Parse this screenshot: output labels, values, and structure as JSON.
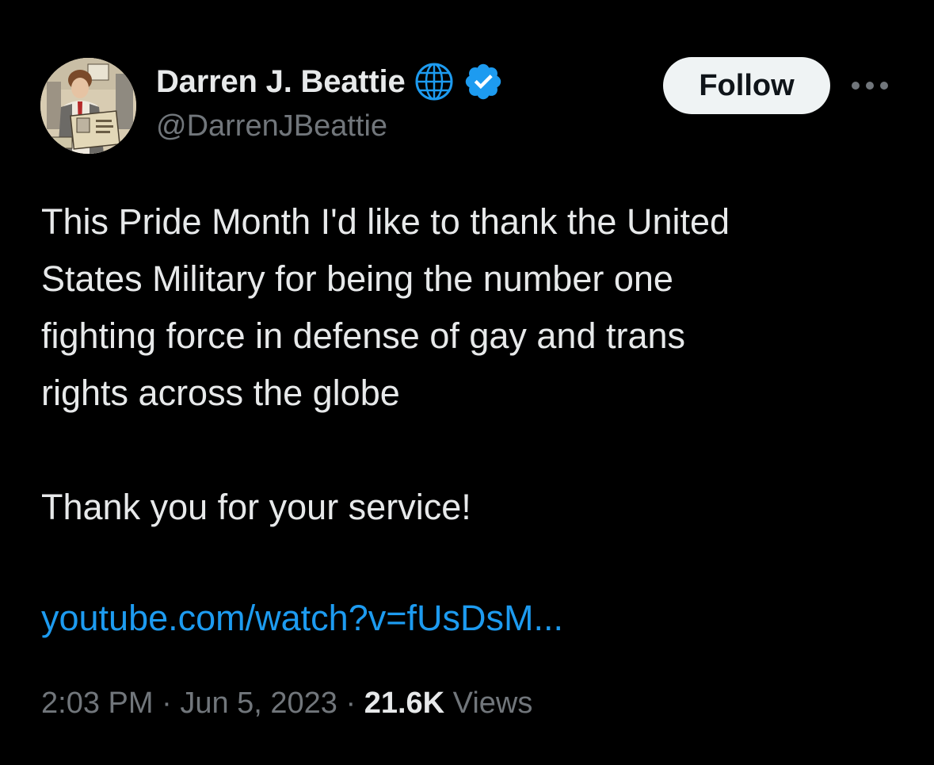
{
  "author": {
    "display_name": "Darren J. Beattie",
    "handle": "@DarrenJBeattie",
    "badges": [
      "globe-icon",
      "verified-badge-icon"
    ]
  },
  "actions": {
    "follow_label": "Follow",
    "more_icon": "more-horizontal-icon"
  },
  "tweet": {
    "lines": [
      "This Pride Month I'd like to thank the United",
      "States Military for being the number one",
      "fighting force in defense of gay and trans",
      "rights across the globe",
      "Thank you for your service!"
    ],
    "link": "youtube.com/watch?v=fUsDsM..."
  },
  "meta": {
    "time": "2:03 PM",
    "separator": "·",
    "date": "Jun 5, 2023",
    "views_count": "21.6K",
    "views_label": "Views"
  },
  "colors": {
    "background": "#000000",
    "text_primary": "#e7e9ea",
    "text_secondary": "#71767b",
    "link": "#1d9bf0",
    "verified": "#1d9bf0",
    "follow_bg": "#eff3f4"
  }
}
